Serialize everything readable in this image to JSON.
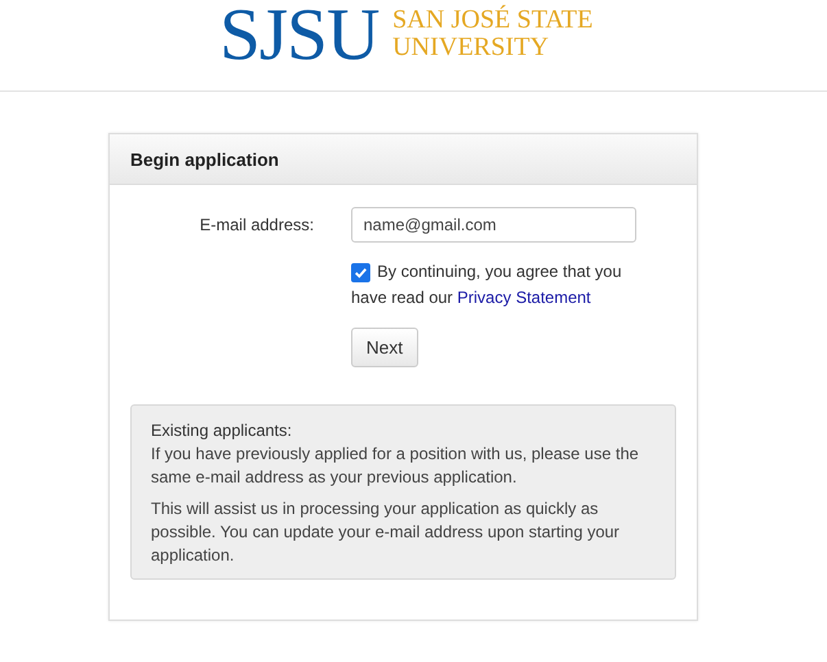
{
  "header": {
    "logo": {
      "mark": "SJSU",
      "name_lines": [
        "SAN JOSÉ STATE",
        "UNIVERSITY"
      ]
    }
  },
  "card": {
    "title": "Begin application",
    "email": {
      "label": "E-mail address:",
      "value": "name@gmail.com"
    },
    "consent": {
      "checked": true,
      "text": "By continuing, you agree that you have read our ",
      "link": "Privacy Statement"
    },
    "button": "Next",
    "info": {
      "title": "Existing applicants:",
      "paragraphs": [
        "If you have previously applied for a position with us, please use the same e-mail address as your previous application.",
        "This will assist us in processing your application as quickly as possible. You can update your e-mail address upon starting your application."
      ]
    }
  }
}
